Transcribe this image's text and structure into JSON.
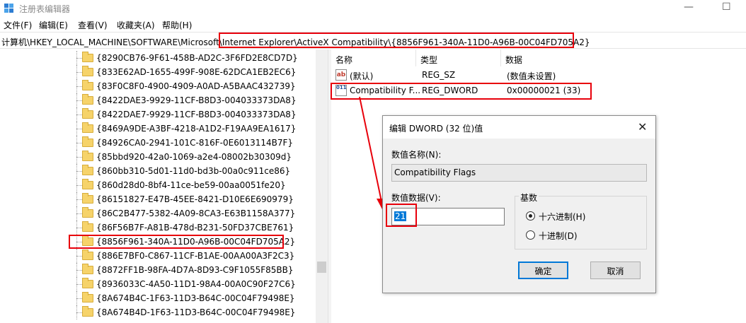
{
  "window": {
    "title": "注册表编辑器",
    "controls": {
      "minimize": "—",
      "maximize": "☐"
    }
  },
  "menu": [
    "文件(F)",
    "编辑(E)",
    "查看(V)",
    "收藏夹(A)",
    "帮助(H)"
  ],
  "address": {
    "path": "计算机\\HKEY_LOCAL_MACHINE\\SOFTWARE\\Microsoft\\Internet Explorer\\ActiveX Compatibility\\{8856F961-340A-11D0-A96B-00C04FD705A2}"
  },
  "tree": {
    "items": [
      "{8290CB76-9F61-458B-AD2C-3F6FD2E8CD7D}",
      "{833E62AD-1655-499F-908E-62DCA1EB2EC6}",
      "{83F0C8F0-4900-4909-A0AD-A5BAAC432739}",
      "{8422DAE3-9929-11CF-B8D3-004033373DA8}",
      "{8422DAE7-9929-11CF-B8D3-004033373DA8}",
      "{8469A9DE-A3BF-4218-A1D2-F19AA9EA1617}",
      "{84926CA0-2941-101C-816F-0E6013114B7F}",
      "{85bbd920-42a0-1069-a2e4-08002b30309d}",
      "{860bb310-5d01-11d0-bd3b-00a0c911ce86}",
      "{860d28d0-8bf4-11ce-be59-00aa0051fe20}",
      "{86151827-E47B-45EE-8421-D10E6E690979}",
      "{86C2B477-5382-4A09-8CA3-E63B1158A377}",
      "{86F56B7F-A81B-478d-B231-50FD37CBE761}",
      "{8856F961-340A-11D0-A96B-00C04FD705A2}",
      "{886E7BF0-C867-11CF-B1AE-00AA00A3F2C3}",
      "{8872FF1B-98FA-4D7A-8D93-C9F1055F85BB}",
      "{8936033C-4A50-11D1-98A4-00A0C90F27C6}",
      "{8A674B4C-1F63-11D3-B64C-00C04F79498E}",
      "{8A674B4D-1F63-11D3-B64C-00C04F79498E}"
    ],
    "selected_index": 13
  },
  "list": {
    "headers": {
      "name": "名称",
      "type": "类型",
      "data": "数据"
    },
    "rows": [
      {
        "icon": "ab",
        "name": "(默认)",
        "type": "REG_SZ",
        "data": "(数值未设置)"
      },
      {
        "icon": "011",
        "name": "Compatibility F...",
        "type": "REG_DWORD",
        "data": "0x00000021 (33)"
      }
    ]
  },
  "dialog": {
    "title": "编辑 DWORD (32 位)值",
    "value_name_label": "数值名称(N):",
    "value_name": "Compatibility Flags",
    "value_data_label": "数值数据(V):",
    "value_data": "21",
    "base_label": "基数",
    "radio_hex": "十六进制(H)",
    "radio_dec": "十进制(D)",
    "base_selected": "hex",
    "ok": "确定",
    "cancel": "取消"
  },
  "colors": {
    "highlight_border": "#e8000b",
    "selection_blue": "#0078d7"
  }
}
